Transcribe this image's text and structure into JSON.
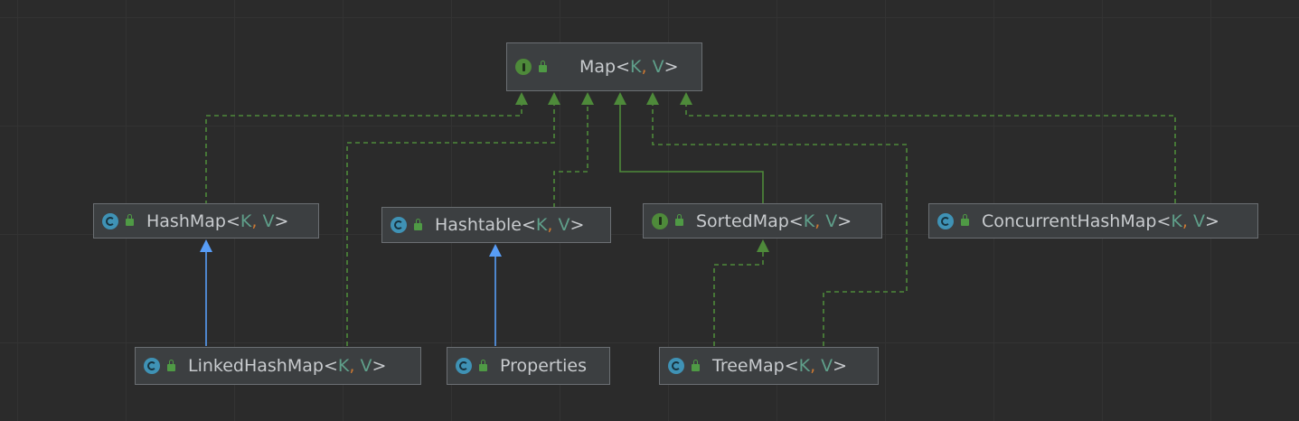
{
  "nodes": {
    "map": {
      "name": "Map",
      "lt": "<",
      "k": "K",
      "comma": ",",
      "v": "V",
      "gt": ">",
      "kind": "interface"
    },
    "hashmap": {
      "name": "HashMap",
      "lt": "<",
      "k": "K",
      "comma": ",",
      "v": "V",
      "gt": ">",
      "kind": "class"
    },
    "hashtable": {
      "name": "Hashtable",
      "lt": "<",
      "k": "K",
      "comma": ",",
      "v": "V",
      "gt": ">",
      "kind": "class"
    },
    "sortedmap": {
      "name": "SortedMap",
      "lt": "<",
      "k": "K",
      "comma": ",",
      "v": "V",
      "gt": ">",
      "kind": "interface"
    },
    "concurrenthashmap": {
      "name": "ConcurrentHashMap",
      "lt": "<",
      "k": "K",
      "comma": ",",
      "v": "V",
      "gt": ">",
      "kind": "class"
    },
    "linkedhashmap": {
      "name": "LinkedHashMap",
      "lt": "<",
      "k": "K",
      "comma": ",",
      "v": "V",
      "gt": ">",
      "kind": "class"
    },
    "properties": {
      "name": "Properties",
      "kind": "class"
    },
    "treemap": {
      "name": "TreeMap",
      "lt": "<",
      "k": "K",
      "comma": ",",
      "v": "V",
      "gt": ">",
      "kind": "class"
    }
  },
  "edges": [
    {
      "from": "hashmap",
      "to": "map",
      "type": "implements"
    },
    {
      "from": "linkedhashmap",
      "to": "map",
      "type": "implements"
    },
    {
      "from": "hashtable",
      "to": "map",
      "type": "implements"
    },
    {
      "from": "sortedmap",
      "to": "map",
      "type": "extends-interface"
    },
    {
      "from": "treemap",
      "to": "map",
      "type": "implements"
    },
    {
      "from": "concurrenthashmap",
      "to": "map",
      "type": "implements"
    },
    {
      "from": "linkedhashmap",
      "to": "hashmap",
      "type": "extends-class"
    },
    {
      "from": "properties",
      "to": "hashtable",
      "type": "extends-class"
    },
    {
      "from": "treemap",
      "to": "sortedmap",
      "type": "implements"
    }
  ],
  "colors": {
    "background": "#2b2b2b",
    "node_fill": "#3c3f41",
    "node_border": "#6b6f73",
    "text": "#c8cbce",
    "type_param": "#5f9f8a",
    "comma": "#cc7832",
    "implements_edge": "#4e8a3a",
    "extends_class_edge": "#589df6",
    "interface_badge": "#4e8a3a",
    "class_badge": "#3f92b5"
  },
  "icons": {
    "interface": "interface-icon",
    "class": "class-icon",
    "visibility": "public-lock-icon"
  }
}
